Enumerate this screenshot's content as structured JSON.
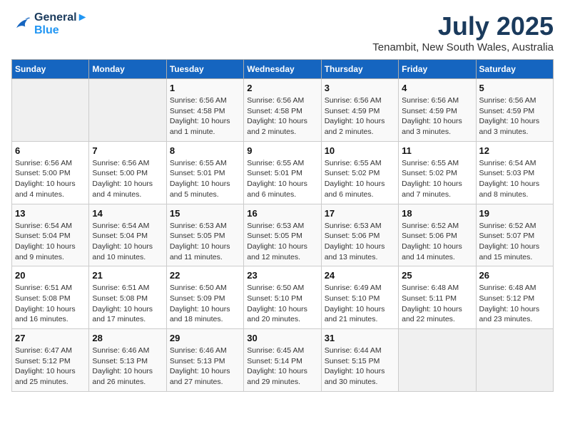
{
  "header": {
    "logo": {
      "line1": "General",
      "line2": "Blue"
    },
    "title": "July 2025",
    "subtitle": "Tenambit, New South Wales, Australia"
  },
  "calendar": {
    "days_of_week": [
      "Sunday",
      "Monday",
      "Tuesday",
      "Wednesday",
      "Thursday",
      "Friday",
      "Saturday"
    ],
    "weeks": [
      [
        {
          "day": "",
          "info": ""
        },
        {
          "day": "",
          "info": ""
        },
        {
          "day": "1",
          "info": "Sunrise: 6:56 AM\nSunset: 4:58 PM\nDaylight: 10 hours and 1 minute."
        },
        {
          "day": "2",
          "info": "Sunrise: 6:56 AM\nSunset: 4:58 PM\nDaylight: 10 hours and 2 minutes."
        },
        {
          "day": "3",
          "info": "Sunrise: 6:56 AM\nSunset: 4:59 PM\nDaylight: 10 hours and 2 minutes."
        },
        {
          "day": "4",
          "info": "Sunrise: 6:56 AM\nSunset: 4:59 PM\nDaylight: 10 hours and 3 minutes."
        },
        {
          "day": "5",
          "info": "Sunrise: 6:56 AM\nSunset: 4:59 PM\nDaylight: 10 hours and 3 minutes."
        }
      ],
      [
        {
          "day": "6",
          "info": "Sunrise: 6:56 AM\nSunset: 5:00 PM\nDaylight: 10 hours and 4 minutes."
        },
        {
          "day": "7",
          "info": "Sunrise: 6:56 AM\nSunset: 5:00 PM\nDaylight: 10 hours and 4 minutes."
        },
        {
          "day": "8",
          "info": "Sunrise: 6:55 AM\nSunset: 5:01 PM\nDaylight: 10 hours and 5 minutes."
        },
        {
          "day": "9",
          "info": "Sunrise: 6:55 AM\nSunset: 5:01 PM\nDaylight: 10 hours and 6 minutes."
        },
        {
          "day": "10",
          "info": "Sunrise: 6:55 AM\nSunset: 5:02 PM\nDaylight: 10 hours and 6 minutes."
        },
        {
          "day": "11",
          "info": "Sunrise: 6:55 AM\nSunset: 5:02 PM\nDaylight: 10 hours and 7 minutes."
        },
        {
          "day": "12",
          "info": "Sunrise: 6:54 AM\nSunset: 5:03 PM\nDaylight: 10 hours and 8 minutes."
        }
      ],
      [
        {
          "day": "13",
          "info": "Sunrise: 6:54 AM\nSunset: 5:04 PM\nDaylight: 10 hours and 9 minutes."
        },
        {
          "day": "14",
          "info": "Sunrise: 6:54 AM\nSunset: 5:04 PM\nDaylight: 10 hours and 10 minutes."
        },
        {
          "day": "15",
          "info": "Sunrise: 6:53 AM\nSunset: 5:05 PM\nDaylight: 10 hours and 11 minutes."
        },
        {
          "day": "16",
          "info": "Sunrise: 6:53 AM\nSunset: 5:05 PM\nDaylight: 10 hours and 12 minutes."
        },
        {
          "day": "17",
          "info": "Sunrise: 6:53 AM\nSunset: 5:06 PM\nDaylight: 10 hours and 13 minutes."
        },
        {
          "day": "18",
          "info": "Sunrise: 6:52 AM\nSunset: 5:06 PM\nDaylight: 10 hours and 14 minutes."
        },
        {
          "day": "19",
          "info": "Sunrise: 6:52 AM\nSunset: 5:07 PM\nDaylight: 10 hours and 15 minutes."
        }
      ],
      [
        {
          "day": "20",
          "info": "Sunrise: 6:51 AM\nSunset: 5:08 PM\nDaylight: 10 hours and 16 minutes."
        },
        {
          "day": "21",
          "info": "Sunrise: 6:51 AM\nSunset: 5:08 PM\nDaylight: 10 hours and 17 minutes."
        },
        {
          "day": "22",
          "info": "Sunrise: 6:50 AM\nSunset: 5:09 PM\nDaylight: 10 hours and 18 minutes."
        },
        {
          "day": "23",
          "info": "Sunrise: 6:50 AM\nSunset: 5:10 PM\nDaylight: 10 hours and 20 minutes."
        },
        {
          "day": "24",
          "info": "Sunrise: 6:49 AM\nSunset: 5:10 PM\nDaylight: 10 hours and 21 minutes."
        },
        {
          "day": "25",
          "info": "Sunrise: 6:48 AM\nSunset: 5:11 PM\nDaylight: 10 hours and 22 minutes."
        },
        {
          "day": "26",
          "info": "Sunrise: 6:48 AM\nSunset: 5:12 PM\nDaylight: 10 hours and 23 minutes."
        }
      ],
      [
        {
          "day": "27",
          "info": "Sunrise: 6:47 AM\nSunset: 5:12 PM\nDaylight: 10 hours and 25 minutes."
        },
        {
          "day": "28",
          "info": "Sunrise: 6:46 AM\nSunset: 5:13 PM\nDaylight: 10 hours and 26 minutes."
        },
        {
          "day": "29",
          "info": "Sunrise: 6:46 AM\nSunset: 5:13 PM\nDaylight: 10 hours and 27 minutes."
        },
        {
          "day": "30",
          "info": "Sunrise: 6:45 AM\nSunset: 5:14 PM\nDaylight: 10 hours and 29 minutes."
        },
        {
          "day": "31",
          "info": "Sunrise: 6:44 AM\nSunset: 5:15 PM\nDaylight: 10 hours and 30 minutes."
        },
        {
          "day": "",
          "info": ""
        },
        {
          "day": "",
          "info": ""
        }
      ]
    ]
  }
}
